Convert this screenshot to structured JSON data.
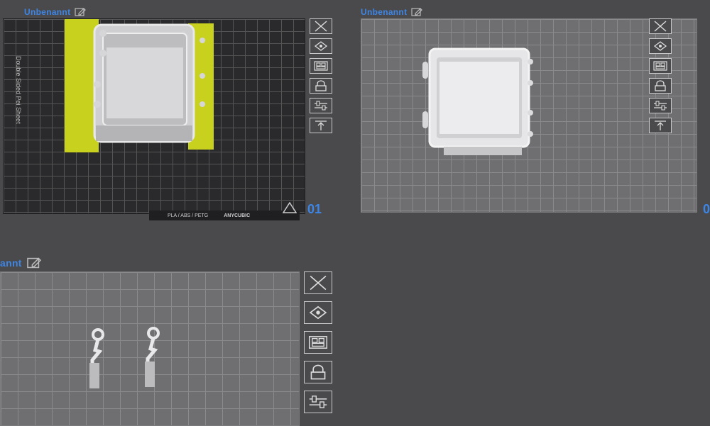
{
  "plates": [
    {
      "title": "Unbenannt",
      "number": "01",
      "sheet_label": "Double Sided Pei Sheet",
      "strip_material": "PLA / ABS / PETG",
      "strip_brand": "ANYCUBIC"
    },
    {
      "title": "Unbenannt",
      "number": "0"
    },
    {
      "title": "annt"
    }
  ],
  "icons": [
    "close-icon",
    "auto-orient-icon",
    "arrange-icon",
    "lock-icon",
    "settings-sliders-icon",
    "move-to-top-icon"
  ],
  "colors": {
    "accent": "#3d86e6",
    "highlight": "#c8d21e",
    "model": "#d9d9d9"
  }
}
